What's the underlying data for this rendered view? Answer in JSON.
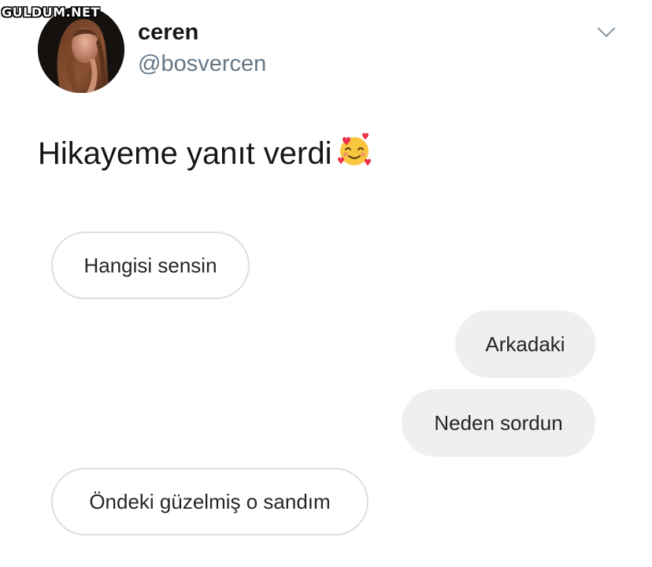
{
  "watermark": "GULDUM.NET",
  "tweet": {
    "display_name": "ceren",
    "handle": "@bosvercen",
    "text": "Hikayeme yanıt verdi",
    "emoji": "smiling-face-with-hearts-icon"
  },
  "messages": [
    {
      "side": "left",
      "text": "Hangisi sensin"
    },
    {
      "side": "right",
      "text": "Arkadaki"
    },
    {
      "side": "right",
      "text": "Neden sordun"
    },
    {
      "side": "left",
      "text": "Öndeki güzelmiş o sandım"
    }
  ],
  "icons": {
    "menu": "chevron-down-icon"
  },
  "colors": {
    "handle_gray": "#657786",
    "bubble_gray": "#efefef",
    "bubble_border": "#dedede"
  }
}
